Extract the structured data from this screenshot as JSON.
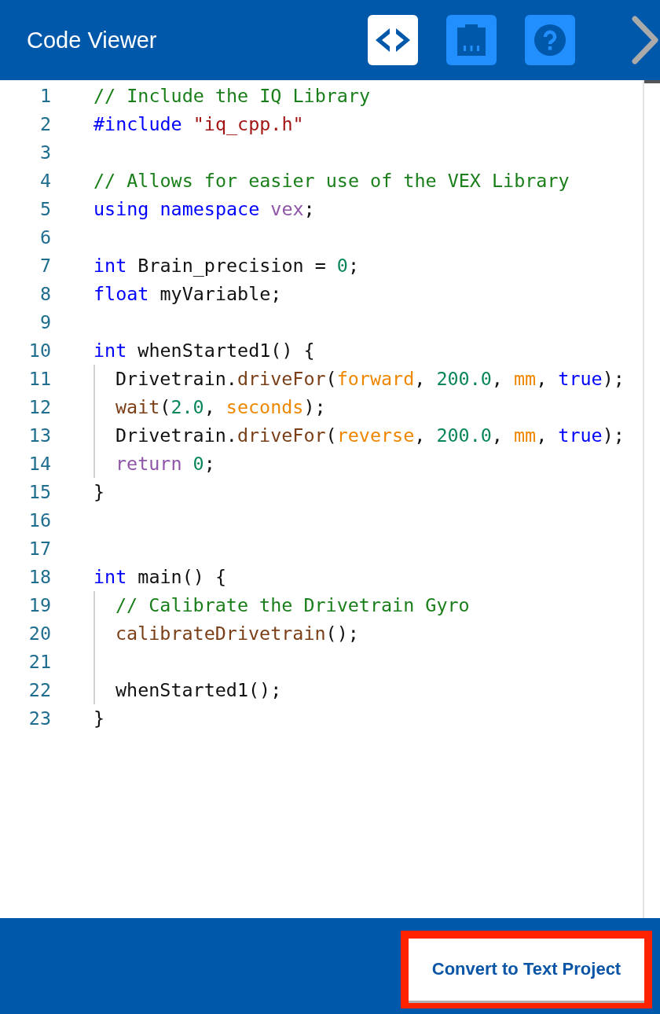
{
  "header": {
    "title": "Code Viewer",
    "tools": [
      {
        "kind": "code",
        "selected": true
      },
      {
        "kind": "device",
        "selected": false
      },
      {
        "kind": "help",
        "selected": false
      }
    ]
  },
  "code": {
    "lines": [
      {
        "number": "1",
        "tokens": [
          {
            "kind": "comment",
            "t": "// Include the IQ Library"
          }
        ]
      },
      {
        "number": "2",
        "tokens": [
          {
            "kind": "keyword",
            "t": "#include "
          },
          {
            "kind": "string",
            "t": "\"iq_cpp.h\""
          }
        ]
      },
      {
        "number": "3"
      },
      {
        "number": "4",
        "tokens": [
          {
            "kind": "comment",
            "t": "// Allows for easier use of the VEX Library"
          }
        ]
      },
      {
        "number": "5",
        "tokens": [
          {
            "kind": "keyword",
            "t": "using namespace "
          },
          {
            "kind": "purple",
            "t": "vex"
          },
          {
            "kind": "plain",
            "t": ";"
          }
        ]
      },
      {
        "number": "6"
      },
      {
        "number": "7",
        "tokens": [
          {
            "kind": "keyword",
            "t": "int "
          },
          {
            "kind": "plain",
            "t": "Brain_precision = "
          },
          {
            "kind": "number",
            "t": "0"
          },
          {
            "kind": "plain",
            "t": ";"
          }
        ]
      },
      {
        "number": "8",
        "tokens": [
          {
            "kind": "keyword",
            "t": "float "
          },
          {
            "kind": "plain",
            "t": "myVariable;"
          }
        ]
      },
      {
        "number": "9"
      },
      {
        "number": "10",
        "tokens": [
          {
            "kind": "keyword",
            "t": "int "
          },
          {
            "kind": "plain",
            "t": "whenStarted1() {"
          }
        ]
      },
      {
        "number": "11",
        "indent": true,
        "tokens": [
          {
            "kind": "plain",
            "t": "Drivetrain."
          },
          {
            "kind": "func",
            "t": "driveFor"
          },
          {
            "kind": "plain",
            "t": "("
          },
          {
            "kind": "constant",
            "t": "forward"
          },
          {
            "kind": "plain",
            "t": ", "
          },
          {
            "kind": "number",
            "t": "200.0"
          },
          {
            "kind": "plain",
            "t": ", "
          },
          {
            "kind": "constant",
            "t": "mm"
          },
          {
            "kind": "plain",
            "t": ", "
          },
          {
            "kind": "keyword",
            "t": "true"
          },
          {
            "kind": "plain",
            "t": ");"
          }
        ]
      },
      {
        "number": "12",
        "indent": true,
        "tokens": [
          {
            "kind": "func",
            "t": "wait"
          },
          {
            "kind": "plain",
            "t": "("
          },
          {
            "kind": "number",
            "t": "2.0"
          },
          {
            "kind": "plain",
            "t": ", "
          },
          {
            "kind": "constant",
            "t": "seconds"
          },
          {
            "kind": "plain",
            "t": ");"
          }
        ]
      },
      {
        "number": "13",
        "indent": true,
        "tokens": [
          {
            "kind": "plain",
            "t": "Drivetrain."
          },
          {
            "kind": "func",
            "t": "driveFor"
          },
          {
            "kind": "plain",
            "t": "("
          },
          {
            "kind": "constant",
            "t": "reverse"
          },
          {
            "kind": "plain",
            "t": ", "
          },
          {
            "kind": "number",
            "t": "200.0"
          },
          {
            "kind": "plain",
            "t": ", "
          },
          {
            "kind": "constant",
            "t": "mm"
          },
          {
            "kind": "plain",
            "t": ", "
          },
          {
            "kind": "keyword",
            "t": "true"
          },
          {
            "kind": "plain",
            "t": ");"
          }
        ]
      },
      {
        "number": "14",
        "indent": true,
        "tokens": [
          {
            "kind": "purple",
            "t": "return "
          },
          {
            "kind": "number",
            "t": "0"
          },
          {
            "kind": "plain",
            "t": ";"
          }
        ]
      },
      {
        "number": "15",
        "tokens": [
          {
            "kind": "plain",
            "t": "}"
          }
        ]
      },
      {
        "number": "16"
      },
      {
        "number": "17"
      },
      {
        "number": "18",
        "tokens": [
          {
            "kind": "keyword",
            "t": "int "
          },
          {
            "kind": "plain",
            "t": "main() {"
          }
        ]
      },
      {
        "number": "19",
        "indent": true,
        "tokens": [
          {
            "kind": "comment",
            "t": "// Calibrate the Drivetrain Gyro"
          }
        ]
      },
      {
        "number": "20",
        "indent": true,
        "tokens": [
          {
            "kind": "func",
            "t": "calibrateDrivetrain"
          },
          {
            "kind": "plain",
            "t": "();"
          }
        ]
      },
      {
        "number": "21",
        "indent": true
      },
      {
        "number": "22",
        "indent": true,
        "tokens": [
          {
            "kind": "plain",
            "t": "whenStarted1();"
          }
        ]
      },
      {
        "number": "23",
        "tokens": [
          {
            "kind": "plain",
            "t": "}"
          }
        ]
      }
    ]
  },
  "footer": {
    "button": {
      "label": "Convert to Text Project",
      "highlighted": true
    }
  }
}
